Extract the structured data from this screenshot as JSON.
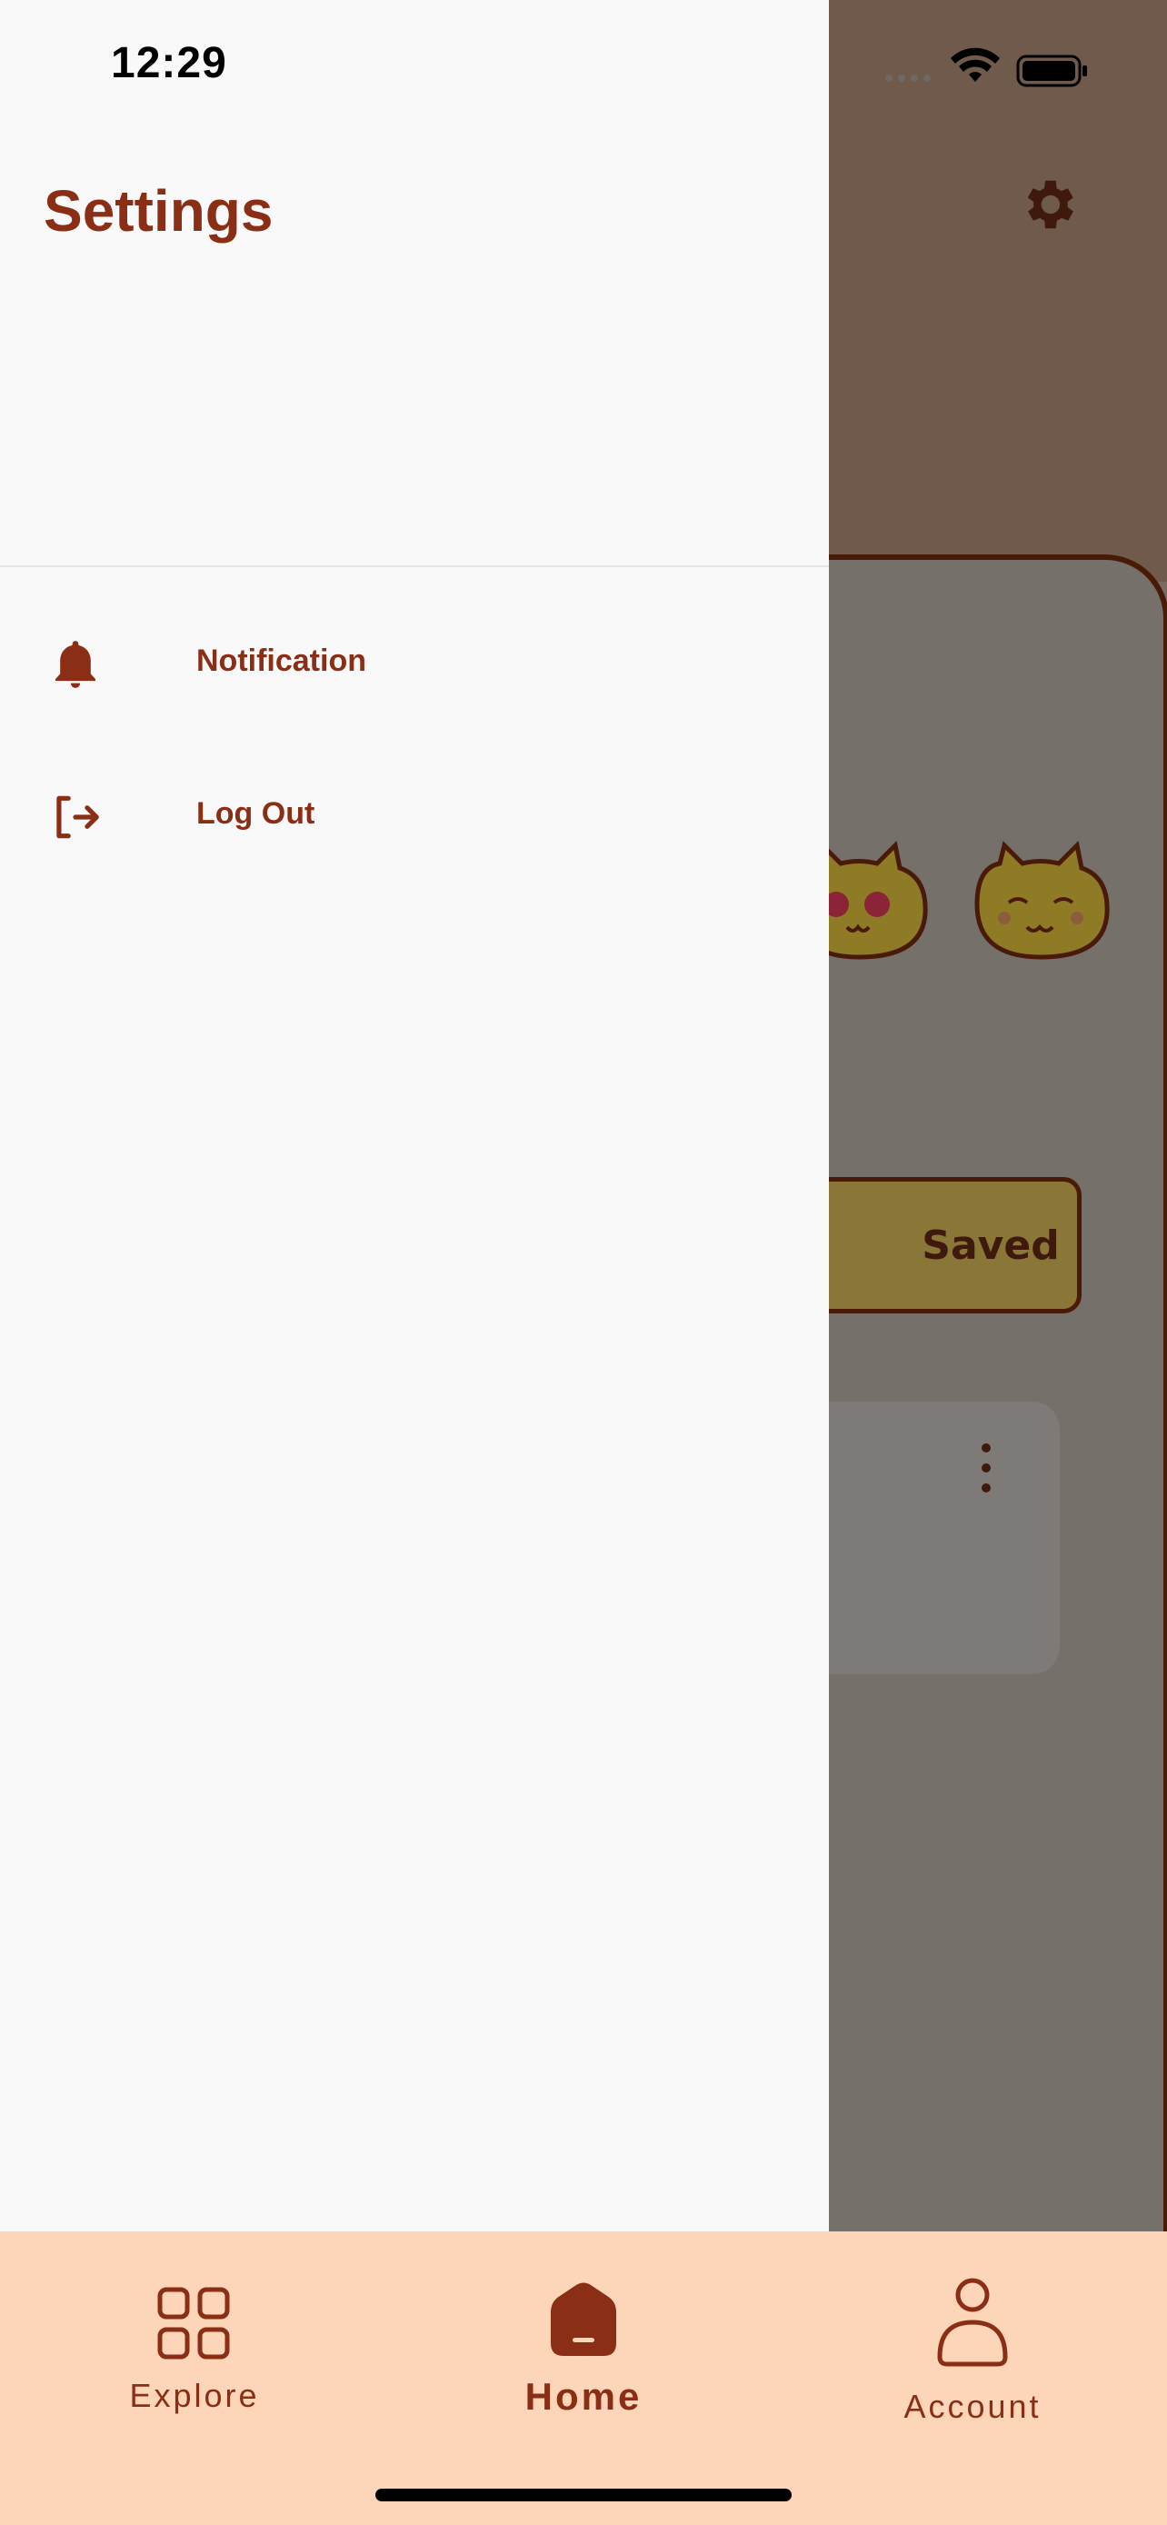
{
  "status_bar": {
    "time": "12:29"
  },
  "drawer": {
    "title": "Settings",
    "items": [
      {
        "label": "Notification",
        "icon": "bell-icon"
      },
      {
        "label": "Log Out",
        "icon": "logout-icon"
      }
    ]
  },
  "background": {
    "saved_button": "Saved",
    "icons": [
      "gear-icon",
      "cat-face-icon",
      "more-vertical-icon"
    ]
  },
  "bottom_nav": {
    "active": "Home",
    "items": [
      {
        "label": "Explore",
        "icon": "grid-icon"
      },
      {
        "label": "Home",
        "icon": "home-icon"
      },
      {
        "label": "Account",
        "icon": "user-icon"
      }
    ]
  },
  "colors": {
    "accent": "#8b2e16",
    "nav_bg": "#fdd5b8",
    "drawer_bg": "#f9f9f9"
  }
}
